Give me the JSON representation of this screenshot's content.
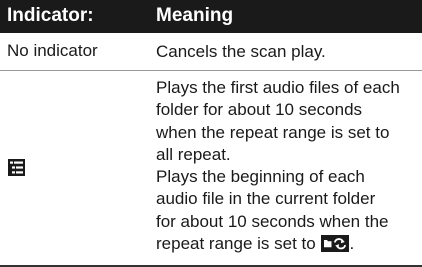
{
  "table": {
    "header": {
      "indicator": "Indicator:",
      "meaning": "Meaning"
    },
    "rows": [
      {
        "indicator_text": "No indicator",
        "meaning_lines": [
          "Cancels the scan play."
        ]
      },
      {
        "indicator_icon": "folder-list-icon",
        "meaning_lines": [
          "Plays the first audio files of each",
          "folder for about 10 seconds",
          "when the repeat range is set to",
          "all repeat.",
          "Plays the beginning of each",
          "audio file in the current folder",
          "for about 10 seconds when the",
          "repeat range is set to",
          "."
        ],
        "inline_icon": "folder-repeat-icon"
      }
    ]
  }
}
